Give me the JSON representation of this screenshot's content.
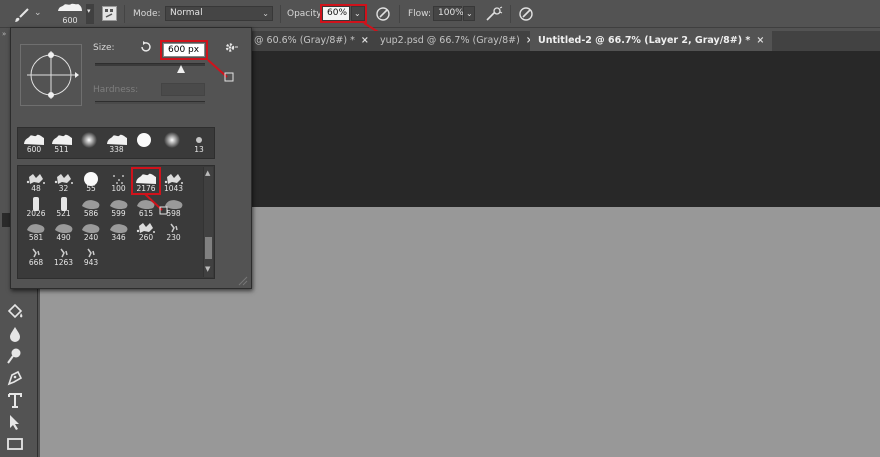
{
  "options_bar": {
    "brush_size": "600",
    "mode_label": "Mode:",
    "mode_value": "Normal",
    "opacity_label": "Opacity:",
    "opacity_value": "60%",
    "flow_label": "Flow:",
    "flow_value": "100%"
  },
  "tabs": [
    {
      "label": "@ 60.6% (Gray/8#) *",
      "close": "×"
    },
    {
      "label": "yup2.psd @ 66.7% (Gray/8#)",
      "close": "×"
    },
    {
      "label": "Untitled-2 @ 66.7% (Layer 2, Gray/8#) *",
      "close": "×",
      "active": true
    }
  ],
  "brush_panel": {
    "size_label": "Size:",
    "size_value": "600 px",
    "size_slider_fraction": 0.78,
    "hardness_label": "Hardness:",
    "recent_presets": [
      "600",
      "511",
      "",
      "338",
      "",
      "",
      "13"
    ],
    "presets": [
      [
        "48",
        "32",
        "55",
        "100",
        "2176",
        "1043"
      ],
      [
        "2026",
        "521",
        "586",
        "599",
        "615",
        "598"
      ],
      [
        "581",
        "490",
        "240",
        "346",
        "260",
        "230"
      ],
      [
        "668",
        "1263",
        "943"
      ]
    ]
  },
  "colors": {
    "highlight": "#d0121b",
    "panel_bg": "#535353",
    "canvas": "#989898",
    "dark_area": "#282828"
  }
}
